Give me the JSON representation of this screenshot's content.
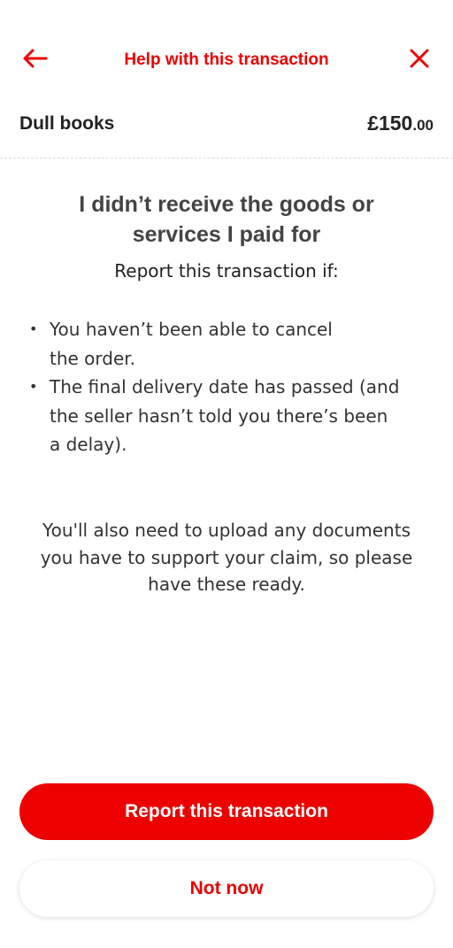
{
  "header": {
    "title": "Help with this transaction",
    "back_icon": "arrow-left-icon",
    "close_icon": "close-icon",
    "accent_color": "#ec0000"
  },
  "transaction": {
    "merchant": "Dull books",
    "amount_main": "£150",
    "amount_pence": ".00"
  },
  "content": {
    "heading_line1": "I didn’t receive the goods or",
    "heading_line2": "services I paid for",
    "subheading": "Report this transaction if:",
    "bullets": [
      {
        "line1": "You haven’t been able to cancel",
        "line2": "the order."
      },
      {
        "line1": "The final delivery date has passed (and",
        "line2": "the seller hasn’t told you there’s been",
        "line3": "a delay)."
      }
    ],
    "footnote_line1": "You'll also need to upload any documents",
    "footnote_line2": "you have to support your claim, so please",
    "footnote_line3": "have these ready."
  },
  "actions": {
    "primary_label": "Report this transaction",
    "secondary_label": "Not now"
  }
}
